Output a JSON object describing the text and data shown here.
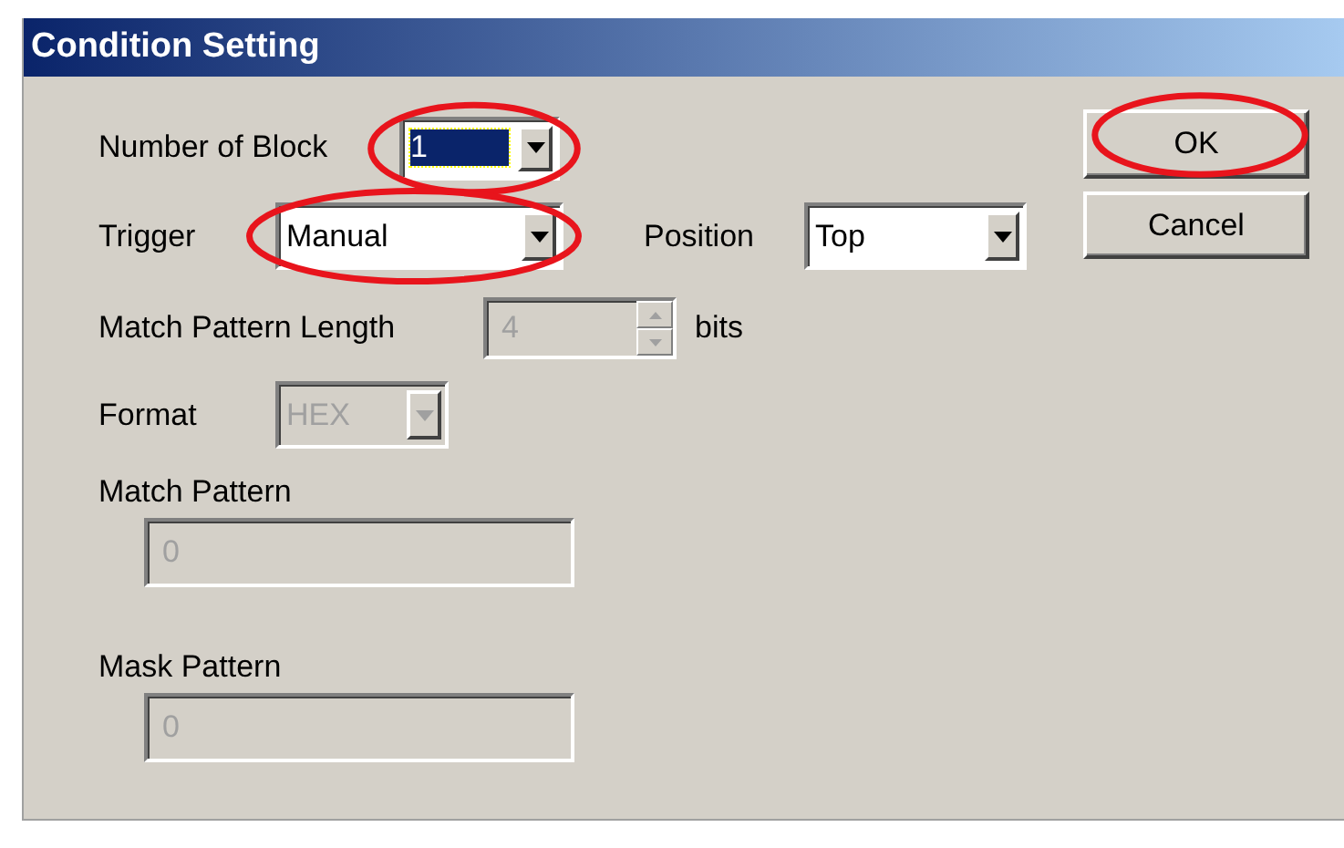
{
  "window": {
    "title": "Condition Setting"
  },
  "number_of_block": {
    "label": "Number of Block",
    "value": "1",
    "focused": true,
    "highlighted": true
  },
  "trigger": {
    "label": "Trigger",
    "value": "Manual",
    "highlighted": true
  },
  "position": {
    "label": "Position",
    "value": "Top",
    "highlighted": false
  },
  "match_pattern_length": {
    "label": "Match Pattern Length",
    "value": "4",
    "unit": "bits",
    "disabled": true
  },
  "format": {
    "label": "Format",
    "value": "HEX",
    "disabled": true
  },
  "match_pattern": {
    "label": "Match Pattern",
    "value": "0",
    "disabled": true
  },
  "mask_pattern": {
    "label": "Mask Pattern",
    "value": "0",
    "disabled": true
  },
  "buttons": [
    {
      "label": "OK",
      "highlighted": true
    },
    {
      "label": "Cancel",
      "highlighted": false
    }
  ]
}
